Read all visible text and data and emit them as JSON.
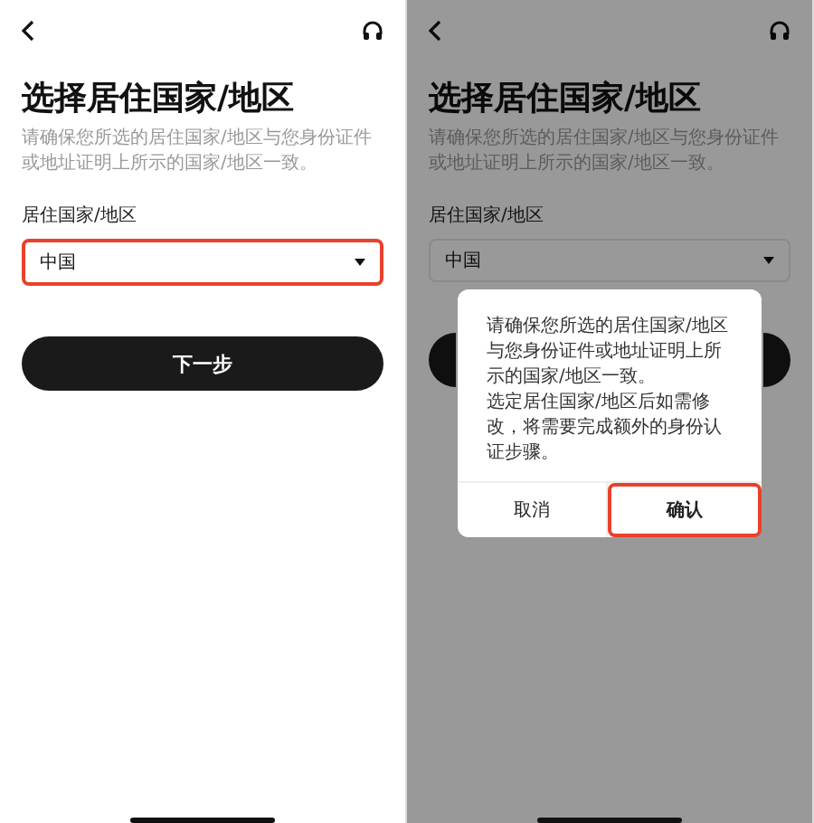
{
  "screens": [
    {
      "title": "选择居住国家/地区",
      "subtitle": "请确保您所选的居住国家/地区与您身份证件或地址证明上所示的国家/地区一致。",
      "field_label": "居住国家/地区",
      "select": {
        "value": "中国",
        "highlighted": true
      },
      "next_button": {
        "label": "下一步"
      },
      "dimmed": false
    },
    {
      "title": "选择居住国家/地区",
      "subtitle": "请确保您所选的居住国家/地区与您身份证件或地址证明上所示的国家/地区一致。",
      "field_label": "居住国家/地区",
      "select": {
        "value": "中国",
        "highlighted": false
      },
      "dimmed": true,
      "dialog": {
        "paragraphs": [
          "请确保您所选的居住国家/地区与您身份证件或地址证明上所示的国家/地区一致。",
          "选定居住国家/地区后如需修改，将需要完成额外的身份认证步骤。"
        ],
        "buttons": [
          {
            "label": "取消",
            "highlighted": false
          },
          {
            "label": "确认",
            "highlighted": true
          }
        ]
      }
    }
  ]
}
